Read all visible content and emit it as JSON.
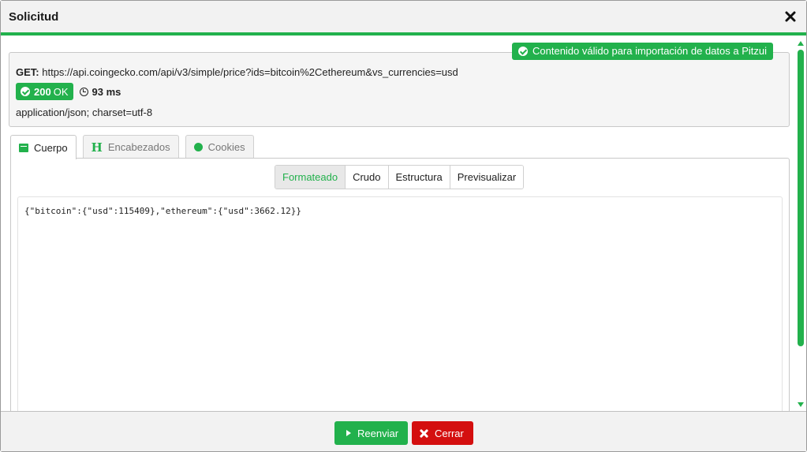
{
  "dialog": {
    "title": "Solicitud",
    "close_icon": "close-icon"
  },
  "toast": {
    "text": "Contenido válido para importación de datos a Pitzui",
    "icon": "check-circle-icon",
    "color": "#22b14c"
  },
  "request": {
    "method": "GET:",
    "url": "https://api.coingecko.com/api/v3/simple/price?ids=bitcoin%2Cethereum&vs_currencies=usd",
    "status_code": "200",
    "status_text": "OK",
    "duration": "93 ms",
    "content_type": "application/json; charset=utf-8"
  },
  "tabs": [
    {
      "label": "Cuerpo",
      "icon": "card-icon",
      "active": true
    },
    {
      "label": "Encabezados",
      "icon": "heading-icon",
      "active": false
    },
    {
      "label": "Cookies",
      "icon": "circle-icon",
      "active": false
    }
  ],
  "views": [
    {
      "label": "Formateado",
      "active": true
    },
    {
      "label": "Crudo",
      "active": false
    },
    {
      "label": "Estructura",
      "active": false
    },
    {
      "label": "Previsualizar",
      "active": false
    }
  ],
  "body_content": "{\"bitcoin\":{\"usd\":115409},\"ethereum\":{\"usd\":3662.12}}",
  "footer": {
    "resend_label": "Reenviar",
    "close_label": "Cerrar"
  },
  "colors": {
    "accent": "#22b14c",
    "danger": "#d40f0f"
  }
}
